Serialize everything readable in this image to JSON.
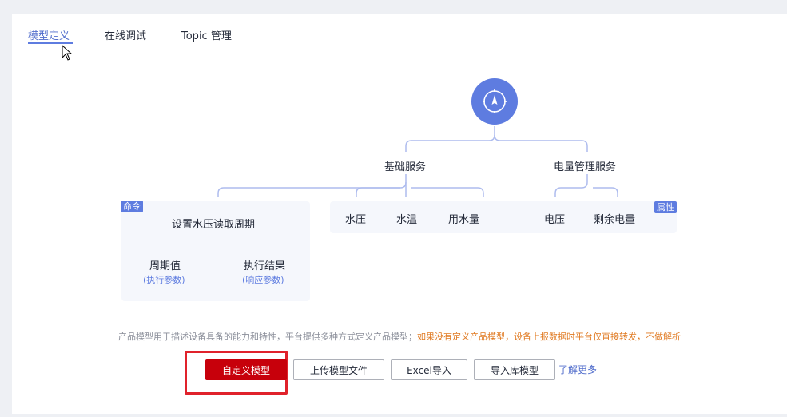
{
  "tabs": [
    {
      "label": "模型定义",
      "active": true
    },
    {
      "label": "在线调试",
      "active": false
    },
    {
      "label": "Topic 管理",
      "active": false
    }
  ],
  "root_icon": "compass-icon",
  "services": [
    {
      "name": "基础服务",
      "properties": [
        "水压",
        "水温",
        "用水量"
      ]
    },
    {
      "name": "电量管理服务",
      "properties": [
        "电压",
        "剩余电量"
      ]
    }
  ],
  "command_box": {
    "badge": "命令",
    "name": "设置水压读取周期",
    "params": [
      {
        "label": "周期值",
        "type": "(执行参数)"
      },
      {
        "label": "执行结果",
        "type": "(响应参数)"
      }
    ]
  },
  "property_badge": "属性",
  "description": {
    "normal": "产品模型用于描述设备具备的能力和特性，平台提供多种方式定义产品模型；",
    "warning": "如果没有定义产品模型，设备上报数据时平台仅直接转发，不做解析"
  },
  "buttons": {
    "custom_model": "自定义模型",
    "upload_model_file": "上传模型文件",
    "excel_import": "Excel导入",
    "import_library_model": "导入库模型"
  },
  "learn_more": "了解更多",
  "colors": {
    "accent": "#5e7ce0",
    "primary_button": "#c7000b",
    "warning_text": "#e07a22",
    "highlight_border": "#e0222b"
  }
}
